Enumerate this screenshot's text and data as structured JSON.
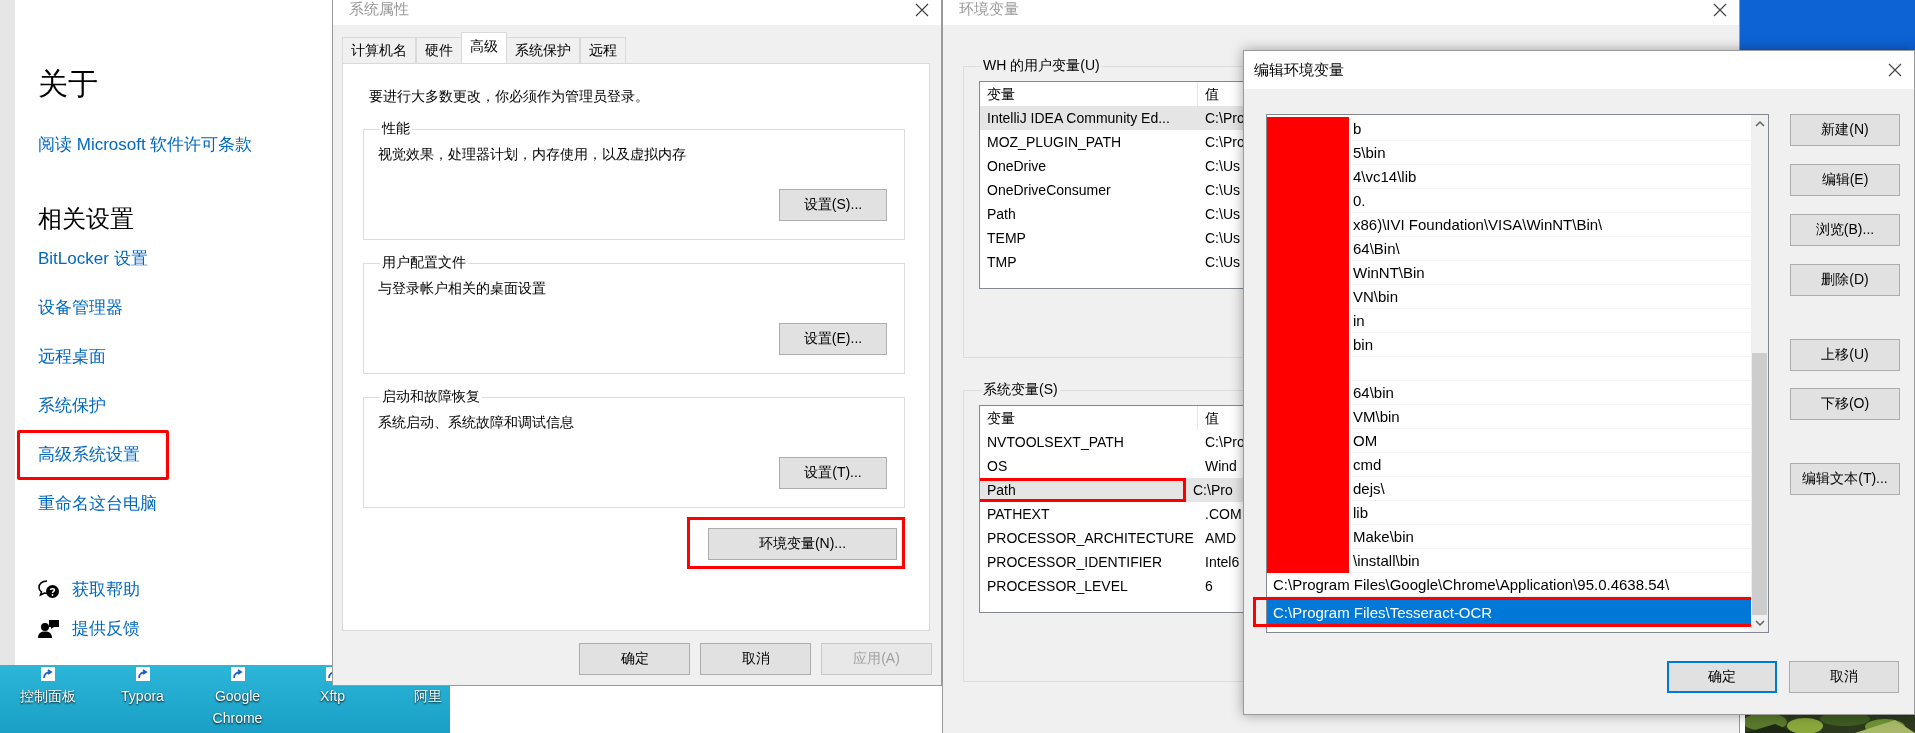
{
  "settings_panel": {
    "title": "关于",
    "license_link": "阅读 Microsoft 软件许可条款",
    "related_heading": "相关设置",
    "links": [
      {
        "label": "BitLocker 设置",
        "highlighted": false
      },
      {
        "label": "设备管理器",
        "highlighted": false
      },
      {
        "label": "远程桌面",
        "highlighted": false
      },
      {
        "label": "系统保护",
        "highlighted": false
      },
      {
        "label": "高级系统设置",
        "highlighted": true
      },
      {
        "label": "重命名这台电脑",
        "highlighted": false
      }
    ],
    "help_links": [
      {
        "kind": "help",
        "label": "获取帮助"
      },
      {
        "kind": "feedback",
        "label": "提供反馈"
      }
    ]
  },
  "desktop_icons": [
    {
      "label": "控制面板",
      "shortcut": true
    },
    {
      "label": "Typora",
      "shortcut": true
    },
    {
      "label": "Google Chrome",
      "shortcut": true
    },
    {
      "label": "Xftp",
      "shortcut": true
    },
    {
      "label": "阿里",
      "shortcut": false
    }
  ],
  "system_properties": {
    "title": "系统属性",
    "tabs": [
      {
        "label": "计算机名",
        "selected": false
      },
      {
        "label": "硬件",
        "selected": false
      },
      {
        "label": "高级",
        "selected": true
      },
      {
        "label": "系统保护",
        "selected": false
      },
      {
        "label": "远程",
        "selected": false
      }
    ],
    "notice": "要进行大多数更改，你必须作为管理员登录。",
    "groups": [
      {
        "title": "性能",
        "description": "视觉效果，处理器计划，内存使用，以及虚拟内存",
        "button": "设置(S)..."
      },
      {
        "title": "用户配置文件",
        "description": "与登录帐户相关的桌面设置",
        "button": "设置(E)..."
      },
      {
        "title": "启动和故障恢复",
        "description": "系统启动、系统故障和调试信息",
        "button": "设置(T)..."
      }
    ],
    "env_button": {
      "label": "环境变量(N)...",
      "highlighted": true
    },
    "buttons": [
      {
        "label": "确定",
        "disabled": false
      },
      {
        "label": "取消",
        "disabled": false
      },
      {
        "label": "应用(A)",
        "disabled": true
      }
    ]
  },
  "env_vars": {
    "title": "环境变量",
    "user_group": {
      "title": "WH 的用户变量(U)",
      "columns": [
        "变量",
        "值"
      ],
      "rows": [
        {
          "name": "IntelliJ IDEA Community Ed...",
          "value": "C:\\Pro",
          "selected": true,
          "highlighted": false
        },
        {
          "name": "MOZ_PLUGIN_PATH",
          "value": "C:\\Pro",
          "selected": false,
          "highlighted": false
        },
        {
          "name": "OneDrive",
          "value": "C:\\Us",
          "selected": false,
          "highlighted": false
        },
        {
          "name": "OneDriveConsumer",
          "value": "C:\\Us",
          "selected": false,
          "highlighted": false
        },
        {
          "name": "Path",
          "value": "C:\\Us",
          "selected": false,
          "highlighted": false
        },
        {
          "name": "TEMP",
          "value": "C:\\Us",
          "selected": false,
          "highlighted": false
        },
        {
          "name": "TMP",
          "value": "C:\\Us",
          "selected": false,
          "highlighted": false
        }
      ]
    },
    "system_group": {
      "title": "系统变量(S)",
      "columns": [
        "变量",
        "值"
      ],
      "rows": [
        {
          "name": "NVTOOLSEXT_PATH",
          "value": "C:\\Pro",
          "selected": false,
          "highlighted": false
        },
        {
          "name": "OS",
          "value": "Wind",
          "selected": false,
          "highlighted": false
        },
        {
          "name": "Path",
          "value": "C:\\Pro",
          "selected": true,
          "highlighted": true
        },
        {
          "name": "PATHEXT",
          "value": ".COM",
          "selected": false,
          "highlighted": false
        },
        {
          "name": "PROCESSOR_ARCHITECTURE",
          "value": "AMD",
          "selected": false,
          "highlighted": false
        },
        {
          "name": "PROCESSOR_IDENTIFIER",
          "value": "Intel6",
          "selected": false,
          "highlighted": false
        },
        {
          "name": "PROCESSOR_LEVEL",
          "value": "6",
          "selected": false,
          "highlighted": false
        }
      ]
    }
  },
  "edit_dialog": {
    "title": "编辑环境变量",
    "entries": [
      {
        "text": "b",
        "redacted": true,
        "selected": false,
        "highlighted": false
      },
      {
        "text": "5\\bin",
        "redacted": true,
        "selected": false,
        "highlighted": false
      },
      {
        "text": "4\\vc14\\lib",
        "redacted": true,
        "selected": false,
        "highlighted": false
      },
      {
        "text": "0.",
        "redacted": true,
        "selected": false,
        "highlighted": false
      },
      {
        "text": "x86)\\IVI Foundation\\VISA\\WinNT\\Bin\\",
        "redacted": true,
        "selected": false,
        "highlighted": false
      },
      {
        "text": "64\\Bin\\",
        "redacted": true,
        "selected": false,
        "highlighted": false
      },
      {
        "text": "WinNT\\Bin",
        "redacted": true,
        "selected": false,
        "highlighted": false
      },
      {
        "text": "VN\\bin",
        "redacted": true,
        "selected": false,
        "highlighted": false
      },
      {
        "text": "in",
        "redacted": true,
        "selected": false,
        "highlighted": false
      },
      {
        "text": "bin",
        "redacted": true,
        "selected": false,
        "highlighted": false
      },
      {
        "redacted": true,
        "selected": false,
        "highlighted": false
      },
      {
        "text": "64\\bin",
        "redacted": true,
        "selected": false,
        "highlighted": false
      },
      {
        "text": "VM\\bin",
        "redacted": true,
        "selected": false,
        "highlighted": false
      },
      {
        "text": "OM",
        "redacted": true,
        "selected": false,
        "highlighted": false
      },
      {
        "text": "cmd",
        "redacted": true,
        "selected": false,
        "highlighted": false
      },
      {
        "text": "dejs\\",
        "redacted": true,
        "selected": false,
        "highlighted": false
      },
      {
        "text": "lib",
        "redacted": true,
        "selected": false,
        "highlighted": false
      },
      {
        "text": "Make\\bin",
        "redacted": true,
        "selected": false,
        "highlighted": false
      },
      {
        "text": "\\install\\bin",
        "redacted": true,
        "selected": false,
        "highlighted": false
      },
      {
        "text": "C:\\Program Files\\Google\\Chrome\\Application\\95.0.4638.54\\",
        "redacted": false,
        "selected": false,
        "highlighted": false
      },
      {
        "text": "C:\\Program Files\\Tesseract-OCR",
        "redacted": false,
        "selected": true,
        "highlighted": true
      }
    ],
    "side_button_groups": [
      {
        "buttons": [
          "新建(N)",
          "编辑(E)",
          "浏览(B)...",
          "删除(D)"
        ]
      },
      {
        "buttons": [
          "上移(U)",
          "下移(O)"
        ]
      },
      {
        "buttons": [
          "编辑文本(T)..."
        ]
      }
    ],
    "buttons": [
      {
        "label": "确定",
        "default": true
      },
      {
        "label": "取消",
        "default": false
      }
    ]
  }
}
